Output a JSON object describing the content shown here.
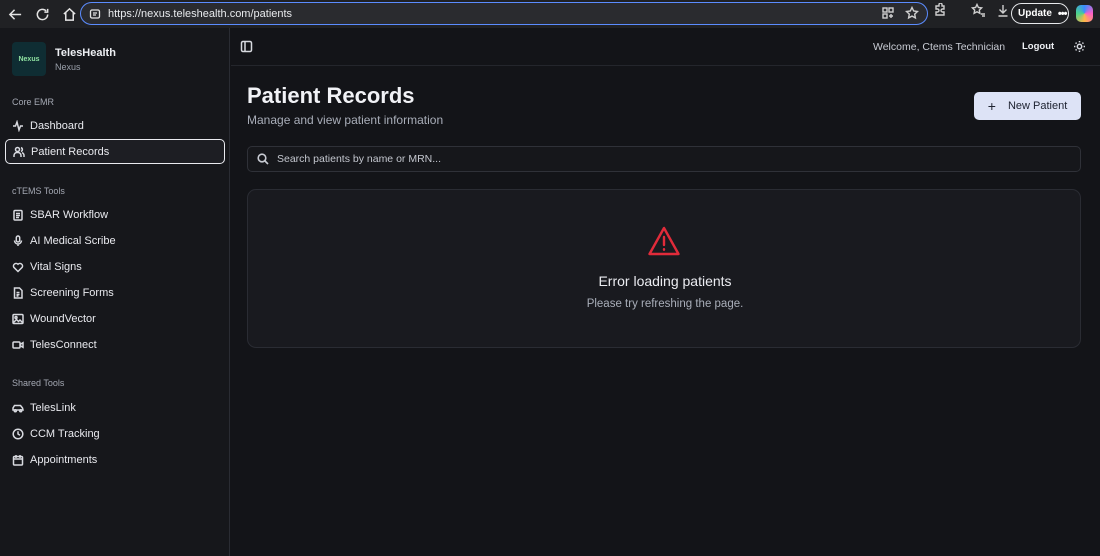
{
  "browser": {
    "url": "https://nexus.teleshealth.com/patients",
    "update_label": "Update",
    "more_label": "•••"
  },
  "sidebar": {
    "brand_title": "TelesHealth",
    "brand_sub": "Nexus",
    "logo_text": "Nexus",
    "sections": [
      {
        "label": "Core EMR",
        "items": [
          {
            "label": "Dashboard",
            "icon": "activity-icon"
          },
          {
            "label": "Patient Records",
            "icon": "users-icon",
            "active": true
          }
        ]
      },
      {
        "label": "cTEMS Tools",
        "items": [
          {
            "label": "SBAR Workflow",
            "icon": "clipboard-icon"
          },
          {
            "label": "AI Medical Scribe",
            "icon": "mic-icon"
          },
          {
            "label": "Vital Signs",
            "icon": "heart-icon"
          },
          {
            "label": "Screening Forms",
            "icon": "file-icon"
          },
          {
            "label": "WoundVector",
            "icon": "image-icon"
          },
          {
            "label": "TelesConnect",
            "icon": "video-icon"
          }
        ]
      },
      {
        "label": "Shared Tools",
        "items": [
          {
            "label": "TelesLink",
            "icon": "car-icon"
          },
          {
            "label": "CCM Tracking",
            "icon": "clock-icon"
          },
          {
            "label": "Appointments",
            "icon": "calendar-icon"
          }
        ]
      }
    ]
  },
  "header": {
    "welcome": "Welcome, Ctems Technician",
    "logout": "Logout"
  },
  "main": {
    "title": "Patient Records",
    "subtitle": "Manage and view patient information",
    "new_button": "New Patient",
    "search_placeholder": "Search patients by name or MRN...",
    "search_value": "",
    "error_title": "Error loading patients",
    "error_message": "Please try refreshing the page."
  },
  "colors": {
    "background": "#131418",
    "sidebar": "#16171b",
    "accent_button": "#dde3f6",
    "error": "#e12b3a"
  }
}
